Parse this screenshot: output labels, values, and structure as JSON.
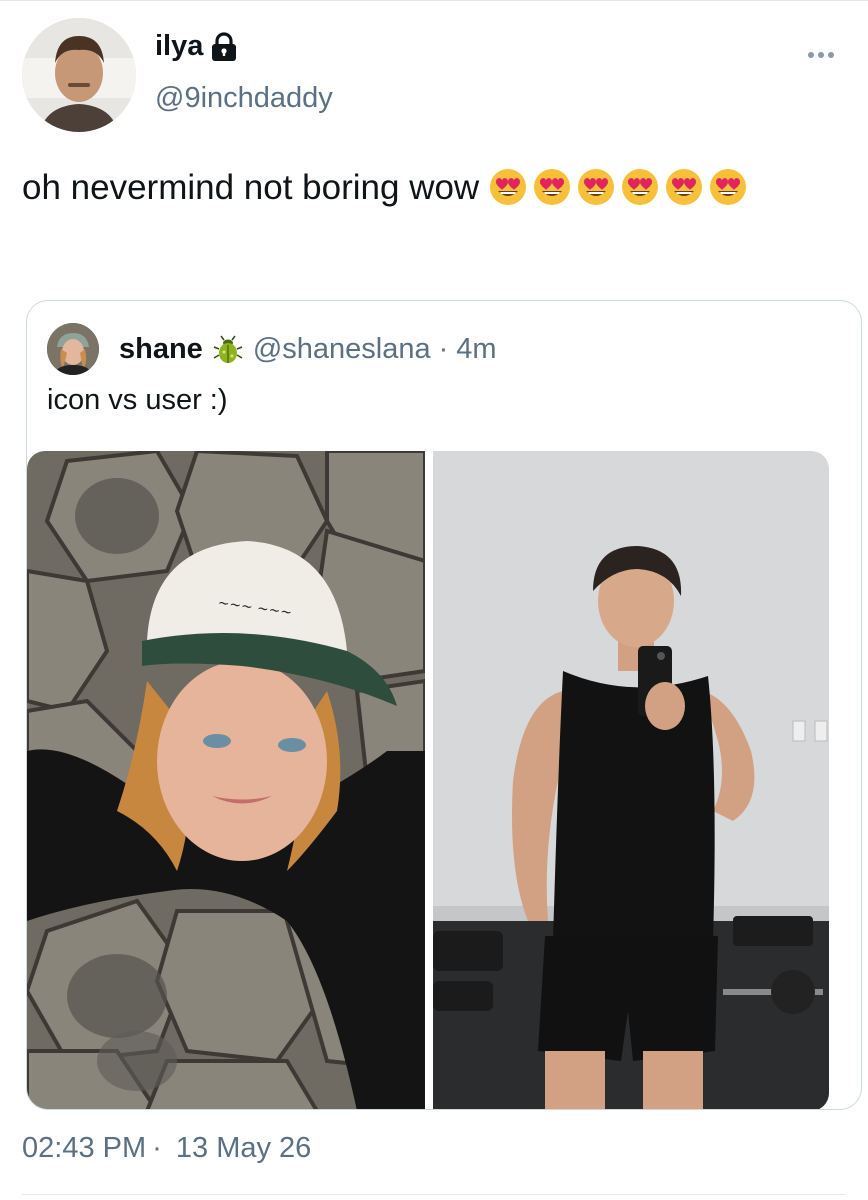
{
  "author": {
    "display_name": "ilya",
    "handle": "@9inchdaddy",
    "protected_icon": "lock-icon"
  },
  "tweet": {
    "text": "oh nevermind not boring wow",
    "emoji": "heart-eyes-emoji",
    "emoji_count": 6
  },
  "quote": {
    "display_name": "shane",
    "name_emoji": "beetle-icon",
    "handle": "@shaneslana",
    "separator": "·",
    "time": "4m",
    "text": "icon vs user :)",
    "images": [
      "selfie-with-cap-on-basalt-columns",
      "gym-mirror-selfie"
    ]
  },
  "meta": {
    "time": "02:43 PM",
    "separator": "·",
    "date": "13 May 26"
  },
  "colors": {
    "text": "#0f1419",
    "secondary": "#5b7083",
    "border": "#cfd9de"
  }
}
